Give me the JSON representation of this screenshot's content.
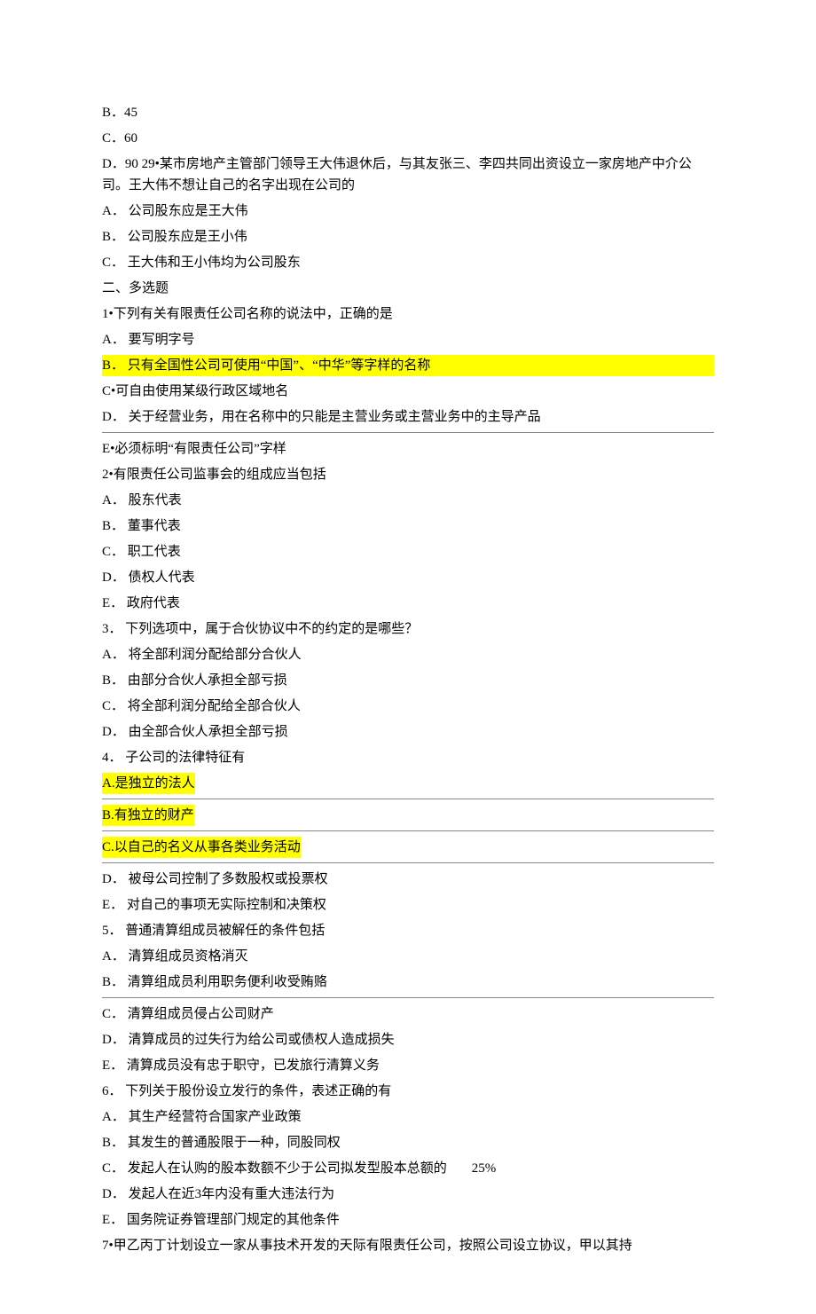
{
  "lines": [
    {
      "text": "B．45",
      "hl": false
    },
    {
      "text": "C．60",
      "hl": false
    },
    {
      "text": "D．90 29•某市房地产主管部门领导王大伟退休后，与其友张三、李四共同出资设立一家房地产中介公司。王大伟不想让自己的名字出现在公司的",
      "hl": false
    },
    {
      "text": "A． 公司股东应是王大伟",
      "hl": false
    },
    {
      "text": "B． 公司股东应是王小伟",
      "hl": false
    },
    {
      "text": "C． 王大伟和王小伟均为公司股东",
      "hl": false
    },
    {
      "text": "二、多选题",
      "hl": false
    },
    {
      "text": "1•下列有关有限责任公司名称的说法中，正确的是",
      "hl": false
    },
    {
      "text": "A． 要写明字号",
      "hl": false
    },
    {
      "text": "B． 只有全国性公司可使用“中国”、“中华”等字样的名称",
      "hl": true,
      "fullwidth": true
    },
    {
      "text": "C•可自由使用某级行政区域地名",
      "hl": false
    },
    {
      "text": "D． 关于经营业务，用在名称中的只能是主营业务或主营业务中的主导产品",
      "hl": false
    },
    {
      "hr": true
    },
    {
      "text": "E•必须标明“有限责任公司”字样",
      "hl": false
    },
    {
      "text": "2•有限责任公司监事会的组成应当包括",
      "hl": false
    },
    {
      "text": "A． 股东代表",
      "hl": false
    },
    {
      "text": "B． 董事代表",
      "hl": false
    },
    {
      "text": "C． 职工代表",
      "hl": false
    },
    {
      "text": "D． 债权人代表",
      "hl": false
    },
    {
      "text": "E． 政府代表",
      "hl": false
    },
    {
      "text": "3． 下列选项中，属于合伙协议中不的约定的是哪些？",
      "hl": false
    },
    {
      "text": "A． 将全部利润分配给部分合伙人",
      "hl": false
    },
    {
      "text": "B． 由部分合伙人承担全部亏损",
      "hl": false
    },
    {
      "text": "C． 将全部利润分配给全部合伙人",
      "hl": false
    },
    {
      "text": "D． 由全部合伙人承担全部亏损",
      "hl": false
    },
    {
      "text": "4． 子公司的法律特征有",
      "hl": false
    },
    {
      "text": "A.是独立的法人",
      "hl": true
    },
    {
      "hr": true
    },
    {
      "text": "B.有独立的财产",
      "hl": true
    },
    {
      "hr": true
    },
    {
      "text": "C.以自己的名义从事各类业务活动",
      "hl": true
    },
    {
      "hr": true
    },
    {
      "text": "D． 被母公司控制了多数股权或投票权",
      "hl": false
    },
    {
      "text": "E． 对自己的事项无实际控制和决策权",
      "hl": false
    },
    {
      "text": "5． 普通清算组成员被解任的条件包括",
      "hl": false
    },
    {
      "text": "A． 清算组成员资格消灭",
      "hl": false
    },
    {
      "text": "B． 清算组成员利用职务便利收受贿赂",
      "hl": false
    },
    {
      "hr": true
    },
    {
      "text": "C． 清算组成员侵占公司财产",
      "hl": false
    },
    {
      "text": "D． 清算成员的过失行为给公司或债权人造成损失",
      "hl": false
    },
    {
      "text": "E． 清算成员没有忠于职守，已发旅行清算义务",
      "hl": false
    },
    {
      "text": "6． 下列关于股份设立发行的条件，表述正确的有",
      "hl": false
    },
    {
      "text": "A． 其生产经营符合国家产业政策",
      "hl": false
    },
    {
      "text": "B． 其发生的普通股限于一种，同股同权",
      "hl": false
    },
    {
      "text": "C． 发起人在认购的股本数额不少于公司拟发型股本总额的",
      "trail": "25%",
      "hl": false
    },
    {
      "text": "D． 发起人在近3年内没有重大违法行为",
      "hl": false
    },
    {
      "text": "E． 国务院证券管理部门规定的其他条件",
      "hl": false
    },
    {
      "text": "7•甲乙丙丁计划设立一家从事技术开发的天际有限责任公司，按照公司设立协议，甲以其持",
      "hl": false
    }
  ]
}
